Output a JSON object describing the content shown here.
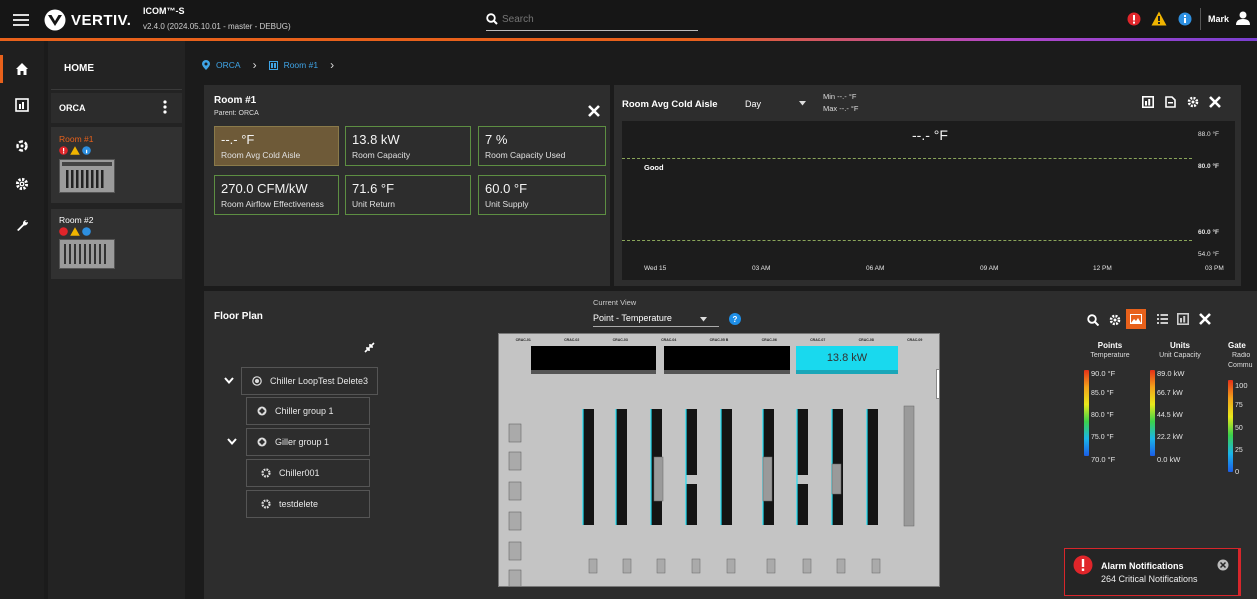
{
  "header": {
    "brand": "VERTIV.",
    "app_name": "ICOM™-S",
    "version": "v2.4.0 (2024.05.10.01 - master - DEBUG)",
    "search_placeholder": "Search",
    "user": "Mark"
  },
  "nav": {
    "home_label": "HOME",
    "site_label": "ORCA",
    "rooms": [
      {
        "label": "Room #1",
        "active": true
      },
      {
        "label": "Room #2",
        "active": false
      }
    ]
  },
  "breadcrumb": {
    "site": "ORCA",
    "room": "Room #1"
  },
  "room_panel": {
    "title": "Room #1",
    "parent": "Parent: ORCA",
    "tiles": [
      {
        "value": "--.- °F",
        "label": "Room Avg Cold Aisle"
      },
      {
        "value": "13.8 kW",
        "label": "Room Capacity"
      },
      {
        "value": "7 %",
        "label": "Room Capacity Used"
      },
      {
        "value": "270.0 CFM/kW",
        "label": "Room Airflow Effectiveness"
      },
      {
        "value": "71.6 °F",
        "label": "Unit Return"
      },
      {
        "value": "60.0 °F",
        "label": "Unit Supply"
      }
    ]
  },
  "trend_panel": {
    "title": "Room Avg Cold Aisle",
    "period": "Day",
    "min": "Min --.- °F",
    "max": "Max --.- °F",
    "current": "--.- °F",
    "band_label": "Good",
    "y_labels": [
      "88.0 °F",
      "80.0 °F",
      "60.0 °F",
      "54.0 °F"
    ],
    "x_labels": [
      "Wed 15",
      "03 AM",
      "06 AM",
      "09 AM",
      "12 PM",
      "03 PM"
    ]
  },
  "floor_plan": {
    "title": "Floor Plan",
    "current_view_label": "Current View",
    "current_view": "Point - Temperature",
    "tree": [
      {
        "label": "Chiller LoopTest Delete3"
      },
      {
        "label": "Chiller group 1"
      },
      {
        "label": "Giller group 1"
      },
      {
        "label": "Chiller001"
      },
      {
        "label": "testdelete"
      }
    ],
    "plan_badge": "13.8 kW",
    "crac_labels": [
      "CRAC-01",
      "CRAC-02",
      "CRAC-03",
      "CRAC-04",
      "CRAC-05 B",
      "CRAC-06",
      "CRAC-07",
      "CRAC-08",
      "CRAC-09"
    ],
    "legends": [
      {
        "title": "Points",
        "sub": "Temperature",
        "ticks": [
          "90.0 °F",
          "85.0 °F",
          "80.0 °F",
          "75.0 °F",
          "70.0 °F"
        ]
      },
      {
        "title": "Units",
        "sub": "Unit Capacity",
        "ticks": [
          "89.0 kW",
          "66.7 kW",
          "44.5 kW",
          "22.2 kW",
          "0.0 kW"
        ]
      },
      {
        "title": "Gate",
        "sub": "Radio",
        "sub2": "Commu",
        "ticks": [
          "100",
          "75",
          "50",
          "25",
          "0"
        ]
      }
    ]
  },
  "alarm_toast": {
    "title": "Alarm Notifications",
    "message": "264 Critical Notifications"
  },
  "colors": {
    "accent_orange": "#e8611b",
    "alarm_red": "#e0252a",
    "warning_yellow": "#f0b400",
    "info_blue": "#2d8fe0",
    "tile_border": "#5d8e42",
    "highlight_tile": "#6e5a38",
    "plan_cyan": "#19d9ee"
  }
}
